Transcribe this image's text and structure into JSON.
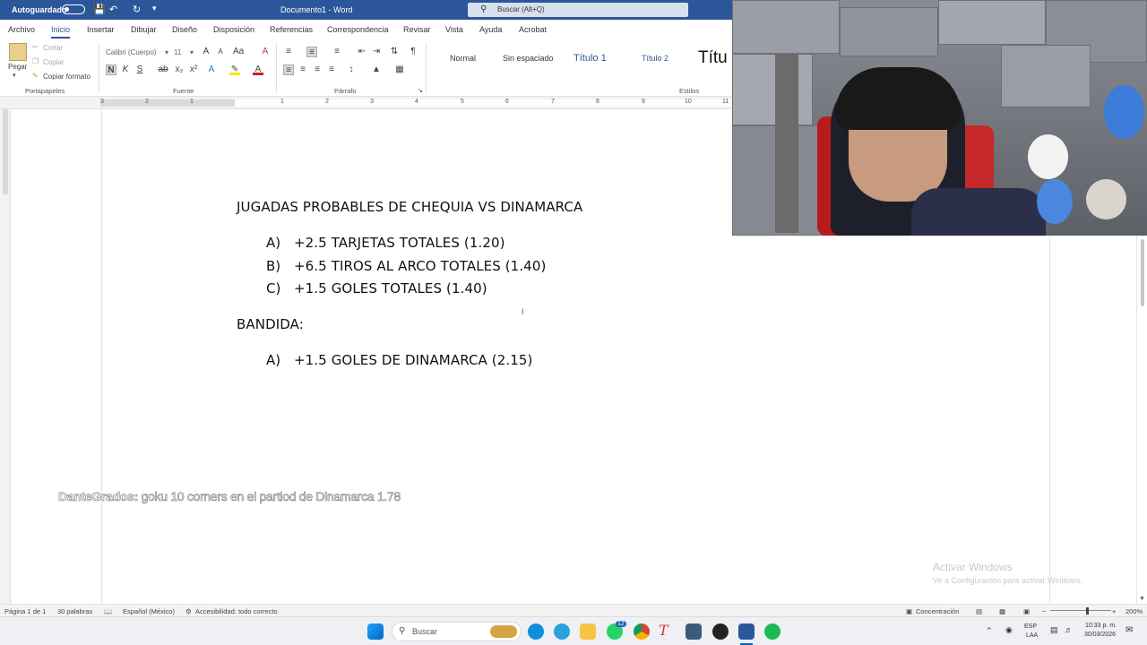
{
  "titlebar": {
    "autosave_label": "Autoguardado",
    "doc_title": "Documento1 - Word",
    "search_placeholder": "Buscar (Alt+Q)"
  },
  "tabs": [
    "Archivo",
    "Inicio",
    "Insertar",
    "Dibujar",
    "Diseño",
    "Disposición",
    "Referencias",
    "Correspondencia",
    "Revisar",
    "Vista",
    "Ayuda",
    "Acrobat"
  ],
  "ribbon": {
    "portapapeles": {
      "paste": "Pegar",
      "cut": "Cortar",
      "copy": "Copiar",
      "format_painter": "Copiar formato",
      "label": "Portapapeles"
    },
    "fuente": {
      "font_name": "Calibri (Cuerpo)",
      "font_size": "11",
      "label": "Fuente"
    },
    "parrafo": {
      "label": "Párrafo"
    },
    "estilos": {
      "items": [
        "Normal",
        "Sin espaciado",
        "Título 1",
        "Título 2",
        "Títu"
      ],
      "label": "Estilos"
    }
  },
  "ruler_numbers": [
    "3",
    "2",
    "1",
    "1",
    "2",
    "3",
    "4",
    "5",
    "6",
    "7",
    "8",
    "9",
    "10",
    "11"
  ],
  "document": {
    "heading": "JUGADAS PROBABLES DE CHEQUIA VS DINAMARCA",
    "list1": [
      {
        "letter": "A)",
        "text": "+2.5 TARJETAS TOTALES (1.20)"
      },
      {
        "letter": "B)",
        "text": "+6.5 TIROS AL ARCO TOTALES (1.40)"
      },
      {
        "letter": "C)",
        "text": "+1.5 GOLES TOTALES (1.40)"
      }
    ],
    "subheading": "BANDIDA:",
    "list2": [
      {
        "letter": "A)",
        "text": "+1.5 GOLES DE DINAMARCA (2.15)"
      }
    ]
  },
  "chat": {
    "user": "DanteGrados:",
    "message": "goku 10 corners en el partiod de Dinamarca 1.78"
  },
  "watermark": {
    "line1": "Activar Windows",
    "line2": "Ve a Configuración para activar Windows."
  },
  "statusbar": {
    "page": "Página 1 de 1",
    "words": "30 palabras",
    "language": "Español (México)",
    "accessibility": "Accesibilidad: todo correcto",
    "focus": "Concentración",
    "zoom": "200%"
  },
  "taskbar": {
    "search_placeholder": "Buscar",
    "whatsapp_badge": "12",
    "lang": "ESP",
    "lang_sub": "LAA",
    "time": "10:33 p. m.",
    "date": "30/03/2026"
  }
}
